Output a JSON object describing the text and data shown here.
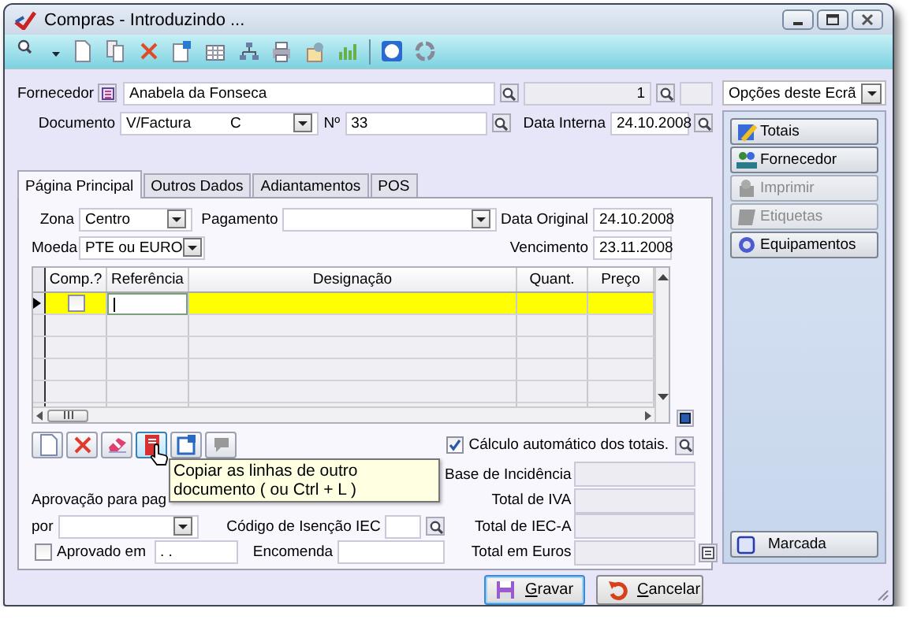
{
  "window": {
    "title": "Compras - Introduzindo ..."
  },
  "header": {
    "supplier": {
      "label": "Fornecedor",
      "value": "Anabela da Fonseca",
      "number": "1"
    },
    "document": {
      "label": "Documento",
      "values": [
        "V/Factura",
        "C"
      ],
      "number_label": "Nº",
      "number": "33",
      "date_label": "Data Interna",
      "date": "24.10.2008"
    }
  },
  "tabs": [
    {
      "label": "Página Principal",
      "selected": true
    },
    {
      "label": "Outros Dados",
      "selected": false
    },
    {
      "label": "Adiantamentos",
      "selected": false
    },
    {
      "label": "POS",
      "selected": false
    }
  ],
  "main": {
    "zone": {
      "label": "Zona",
      "value": "Centro"
    },
    "payment": {
      "label": "Pagamento"
    },
    "original_date": {
      "label": "Data Original",
      "value": "24.10.2008"
    },
    "currency": {
      "label": "Moeda",
      "value": "PTE ou EURO"
    },
    "due_date": {
      "label": "Vencimento",
      "value": "23.11.2008"
    }
  },
  "grid": {
    "columns": [
      "Comp.?",
      "Referência",
      "Designação",
      "Quant.",
      "Preço"
    ],
    "rows": [
      {
        "selected": true,
        "checked": false
      }
    ]
  },
  "auto_totals": {
    "label": "Cálculo automático dos totais.",
    "checked": true
  },
  "totals": [
    {
      "label": "Base de Incidência"
    },
    {
      "label": "Total de IVA"
    },
    {
      "label": "Total de IEC-A"
    },
    {
      "label": "Total em Euros"
    }
  ],
  "approval": {
    "label": "Aprovação para pag",
    "by_label": "por",
    "iec_label": "Código de Isenção IEC",
    "approved": {
      "label": "Aprovado em",
      "checked": false,
      "value": ". ."
    },
    "order_label": "Encomenda"
  },
  "tooltip": "Copiar as linhas de outro documento ( ou Ctrl + L )",
  "buttons": [
    {
      "label": "Gravar",
      "focused": true
    },
    {
      "label": "Cancelar",
      "focused": false
    }
  ],
  "options": {
    "title": "Opções deste Ecrã",
    "actions": [
      {
        "label": "Totais",
        "disabled": false
      },
      {
        "label": "Fornecedor",
        "disabled": false
      },
      {
        "label": "Imprimir",
        "disabled": true
      },
      {
        "label": "Etiquetas",
        "disabled": true
      },
      {
        "label": "Equipamentos",
        "disabled": false
      }
    ],
    "marked": "Marcada"
  }
}
